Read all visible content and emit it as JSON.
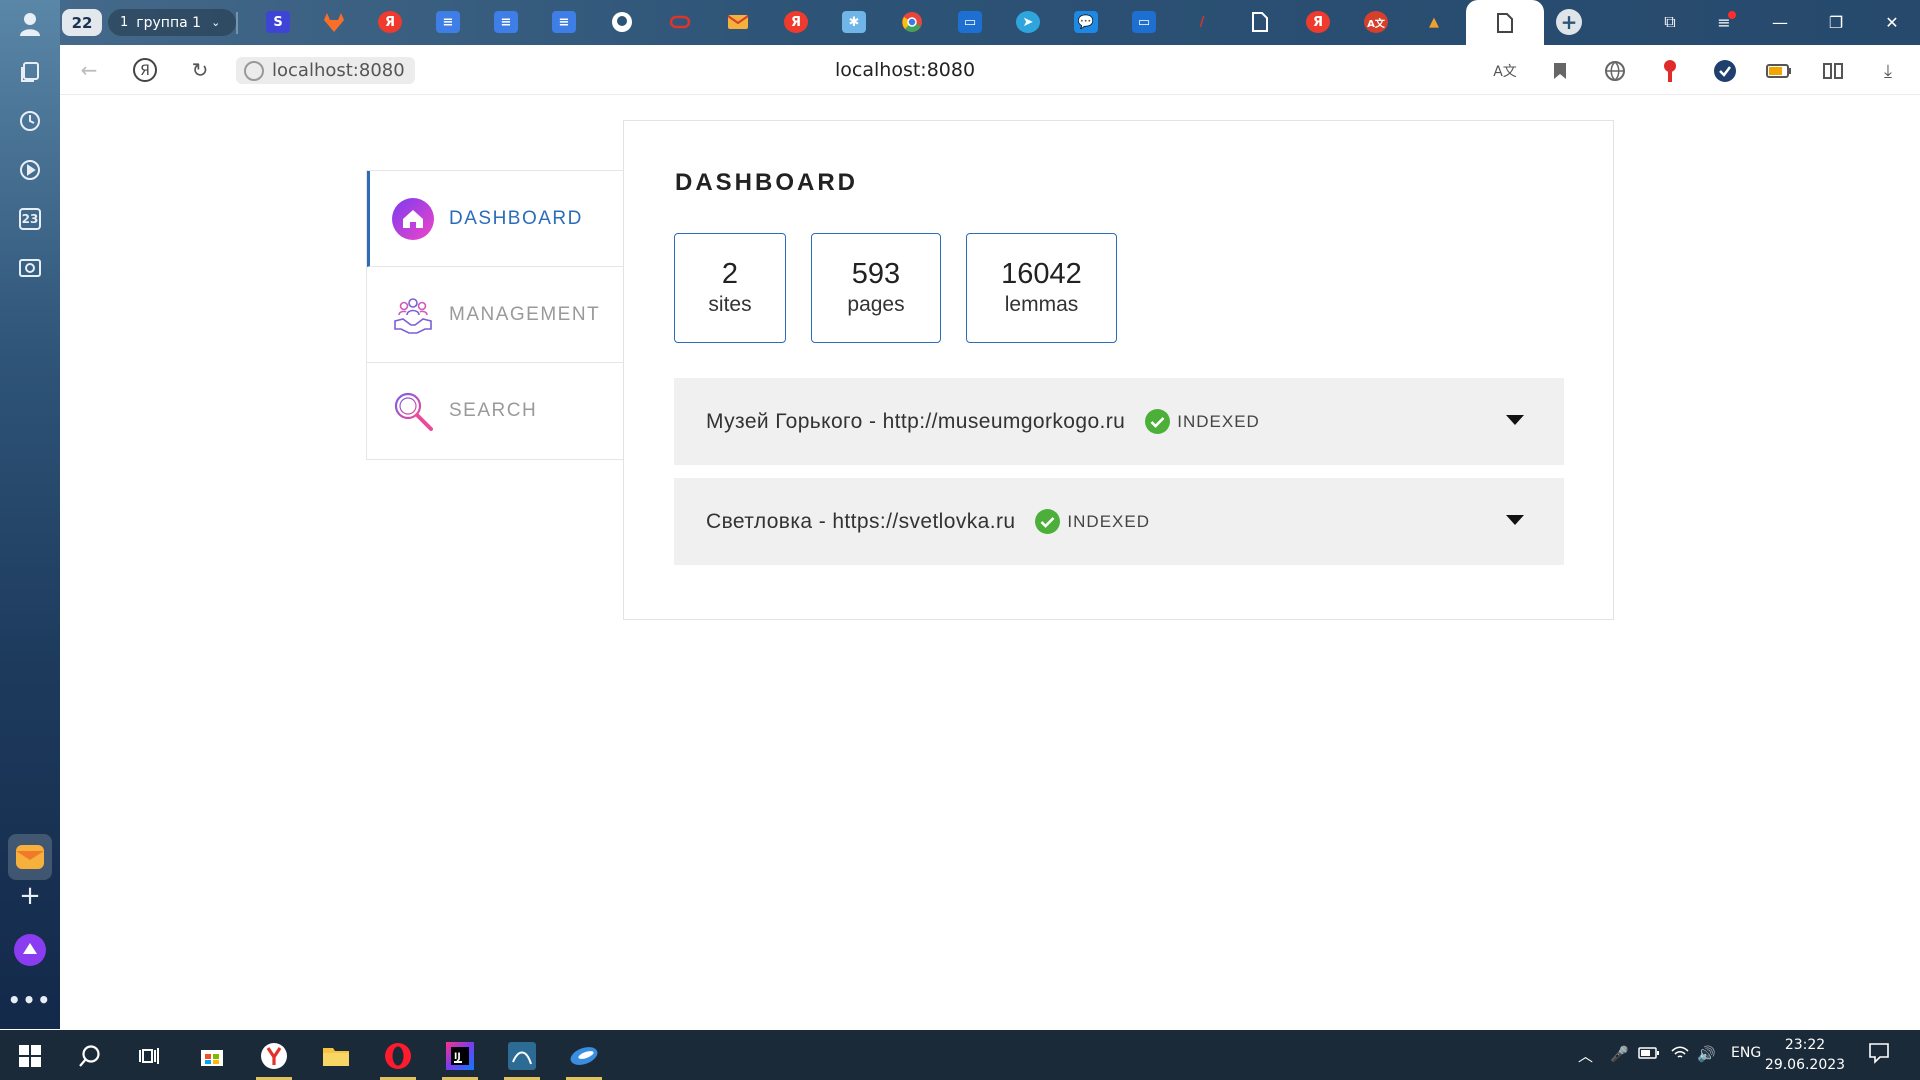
{
  "browser": {
    "tab_count": "22",
    "tab_group": {
      "number": "1",
      "label": "группа 1"
    },
    "address_chip": "localhost:8080",
    "page_host": "localhost:8080",
    "side_badge": "23"
  },
  "app": {
    "nav": [
      {
        "label": "DASHBOARD",
        "icon": "home-icon",
        "active": true
      },
      {
        "label": "MANAGEMENT",
        "icon": "team-handshake-icon",
        "active": false
      },
      {
        "label": "SEARCH",
        "icon": "magnifier-icon",
        "active": false
      }
    ],
    "dashboard": {
      "title": "DASHBOARD",
      "stats": [
        {
          "value": "2",
          "label": "sites"
        },
        {
          "value": "593",
          "label": "pages"
        },
        {
          "value": "16042",
          "label": "lemmas"
        }
      ],
      "sites": [
        {
          "name": "Музей Горького - http://museumgorkogo.ru",
          "status": "INDEXED"
        },
        {
          "name": "Светловка - https://svetlovka.ru",
          "status": "INDEXED"
        }
      ]
    }
  },
  "taskbar": {
    "lang": "ENG",
    "time": "23:22",
    "date": "29.06.2023"
  },
  "colors": {
    "accent_blue": "#2b6db8",
    "indexed_green": "#4caf3a",
    "row_bg": "#f0f0f0"
  }
}
